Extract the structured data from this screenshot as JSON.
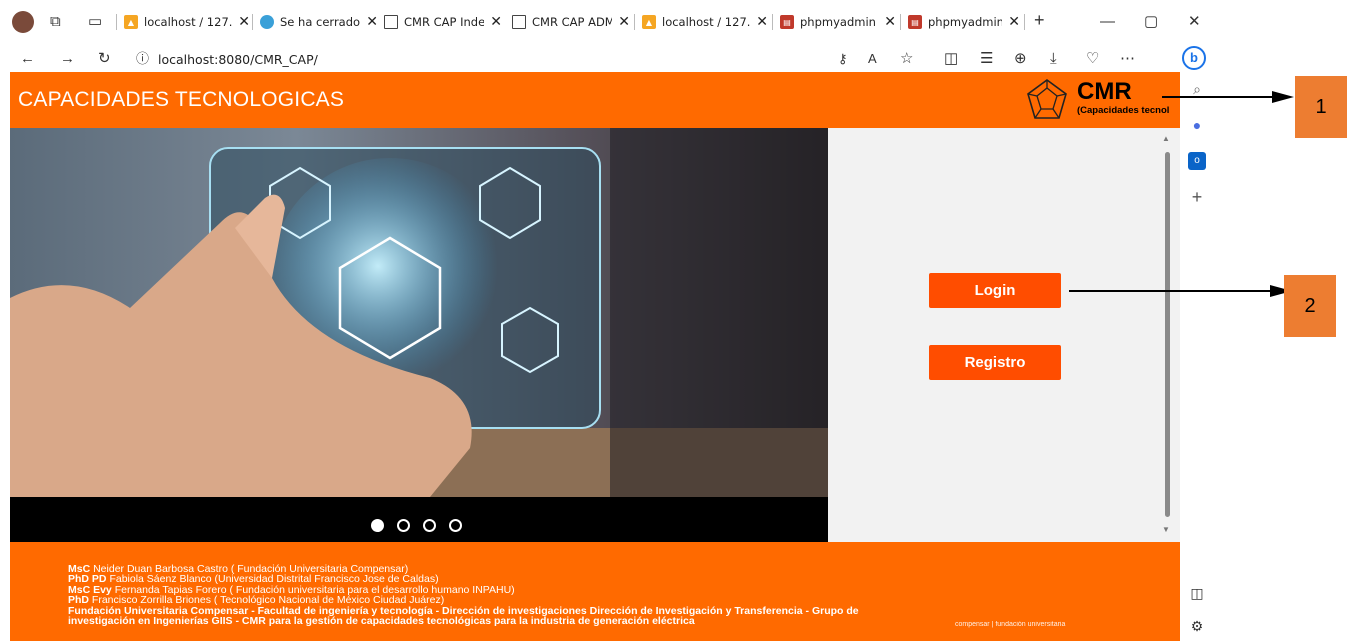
{
  "browser": {
    "tabs": [
      {
        "title": "localhost / 127.",
        "favicon": "phpmyadmin-icon",
        "active": false
      },
      {
        "title": "Se ha cerrado s",
        "favicon": "edge-icon",
        "active": false
      },
      {
        "title": "CMR CAP Index",
        "favicon": "page-icon",
        "active": true
      },
      {
        "title": "CMR CAP ADM",
        "favicon": "page-icon",
        "active": false
      },
      {
        "title": "localhost / 127.",
        "favicon": "phpmyadmin-icon",
        "active": false
      },
      {
        "title": "phpmyadmin (",
        "favicon": "pdf-icon",
        "active": false
      },
      {
        "title": "phpmyadmin.p",
        "favicon": "pdf-icon",
        "active": false
      }
    ],
    "url": "localhost:8080/CMR_CAP/"
  },
  "header": {
    "title": "CAPACIDADES TECNOLOGICAS",
    "logo_main": "CMR",
    "logo_sub": "(Capacidades tecnol"
  },
  "carousel": {
    "indicators": [
      true,
      false,
      false,
      false
    ]
  },
  "side_panel": {
    "login_label": "Login",
    "register_label": "Registro"
  },
  "footer": {
    "credits": [
      {
        "degree": "MsC",
        "text": "Neider Duan Barbosa Castro ( Fundación Universitaria Compensar)"
      },
      {
        "degree": "PhD PD",
        "text": "Fabiola Sáenz Blanco (Universidad Distrital Francisco Jose de Caldas)"
      },
      {
        "degree": "MsC Evy",
        "text": "Fernanda Tapias Forero ( Fundación universitaria para el desarrollo humano INPAHU)"
      },
      {
        "degree": "PhD",
        "text": "Francisco Zorrilla Briones ( Tecnológico Nacional de México Ciudad Juárez)"
      }
    ],
    "institution_line1": "Fundación Universitaria Compensar - Facultad de ingeniería y tecnología - Dirección de investigaciones Dirección de Investigación y Transferencia - Grupo de",
    "institution_line2": "investigación en Ingenierías GIIS - CMR para la gestión de capacidades tecnológicas para la industria de generación eléctrica",
    "partner_logo": "compensar | fundación universitaria"
  },
  "annotations": {
    "one": "1",
    "two": "2"
  },
  "colors": {
    "brand_orange": "#ff6a00",
    "button_orange": "#ff4d00",
    "annotation_orange": "#ed7d31"
  }
}
